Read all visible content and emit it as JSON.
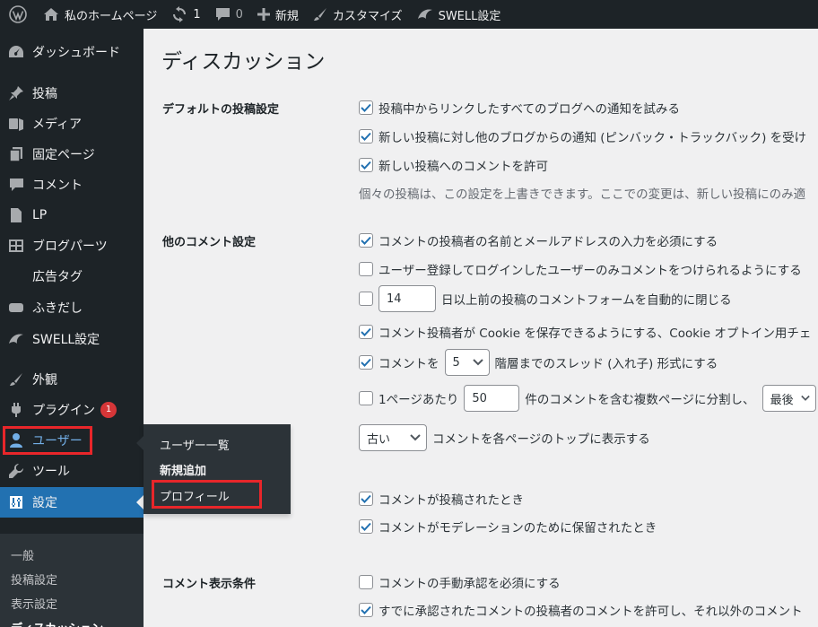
{
  "adminbar": {
    "site_name": "私のホームページ",
    "updates_count": "1",
    "comments_count": "0",
    "new_label": "新規",
    "customize_label": "カスタマイズ",
    "swell_label": "SWELL設定"
  },
  "sidebar": {
    "items": [
      {
        "label": "ダッシュボード",
        "icon": "dashboard-icon"
      },
      {
        "label": "投稿",
        "icon": "pin-icon"
      },
      {
        "label": "メディア",
        "icon": "media-icon"
      },
      {
        "label": "固定ページ",
        "icon": "page-icon"
      },
      {
        "label": "コメント",
        "icon": "comment-icon"
      },
      {
        "label": "LP",
        "icon": "document-icon"
      },
      {
        "label": "ブログパーツ",
        "icon": "grid-icon"
      },
      {
        "label": "広告タグ",
        "icon": ""
      },
      {
        "label": "ふきだし",
        "icon": "bubble-icon"
      },
      {
        "label": "SWELL設定",
        "icon": "swell-icon"
      },
      {
        "label": "外観",
        "icon": "brush-icon"
      },
      {
        "label": "プラグイン",
        "icon": "plugin-icon",
        "badge": "1"
      },
      {
        "label": "ユーザー",
        "icon": "user-icon"
      },
      {
        "label": "ツール",
        "icon": "wrench-icon"
      },
      {
        "label": "設定",
        "icon": "settings-icon"
      }
    ],
    "submenu": [
      "一般",
      "投稿設定",
      "表示設定",
      "ディスカッション"
    ]
  },
  "flyout": {
    "items": [
      "ユーザー一覧",
      "新規追加",
      "プロフィール"
    ]
  },
  "main": {
    "title": "ディスカッション",
    "default_section": {
      "label": "デフォルトの投稿設定",
      "options": [
        {
          "label": "投稿中からリンクしたすべてのブログへの通知を試みる",
          "checked": true
        },
        {
          "label": "新しい投稿に対し他のブログからの通知 (ピンバック・トラックバック) を受け",
          "checked": true
        },
        {
          "label": "新しい投稿へのコメントを許可",
          "checked": true
        }
      ],
      "description": "個々の投稿は、この設定を上書きできます。ここでの変更は、新しい投稿にのみ適"
    },
    "other_section": {
      "label": "他のコメント設定",
      "require_name": "コメントの投稿者の名前とメールアドレスの入力を必須にする",
      "registered_only": "ユーザー登録してログインしたユーザーのみコメントをつけられるようにする",
      "close_days_value": "14",
      "close_days_label": "日以上前の投稿のコメントフォームを自動的に閉じる",
      "cookie_label": "コメント投稿者が Cookie を保存できるようにする、Cookie オプトイン用チェ",
      "thread_prefix": "コメントを",
      "thread_value": "5",
      "thread_suffix": "階層までのスレッド (入れ子) 形式にする",
      "page_prefix": "1ページあたり",
      "page_value": "50",
      "page_suffix": "件のコメントを含む複数ページに分割し、",
      "page_order_value": "最後",
      "order_value": "古い",
      "order_suffix": "コメントを各ページのトップに表示する"
    },
    "email_section": {
      "options": [
        {
          "label": "コメントが投稿されたとき",
          "checked": true
        },
        {
          "label": "コメントがモデレーションのために保留されたとき",
          "checked": true
        }
      ]
    },
    "display_section": {
      "label": "コメント表示条件",
      "options": [
        {
          "label": "コメントの手動承認を必須にする",
          "checked": false
        },
        {
          "label": "すでに承認されたコメントの投稿者のコメントを許可し、それ以外のコメント",
          "checked": true
        }
      ]
    }
  },
  "colors": {
    "accent": "#2271b1",
    "highlight_box": "#e8262a",
    "sidebar_bg": "#1d2327"
  }
}
